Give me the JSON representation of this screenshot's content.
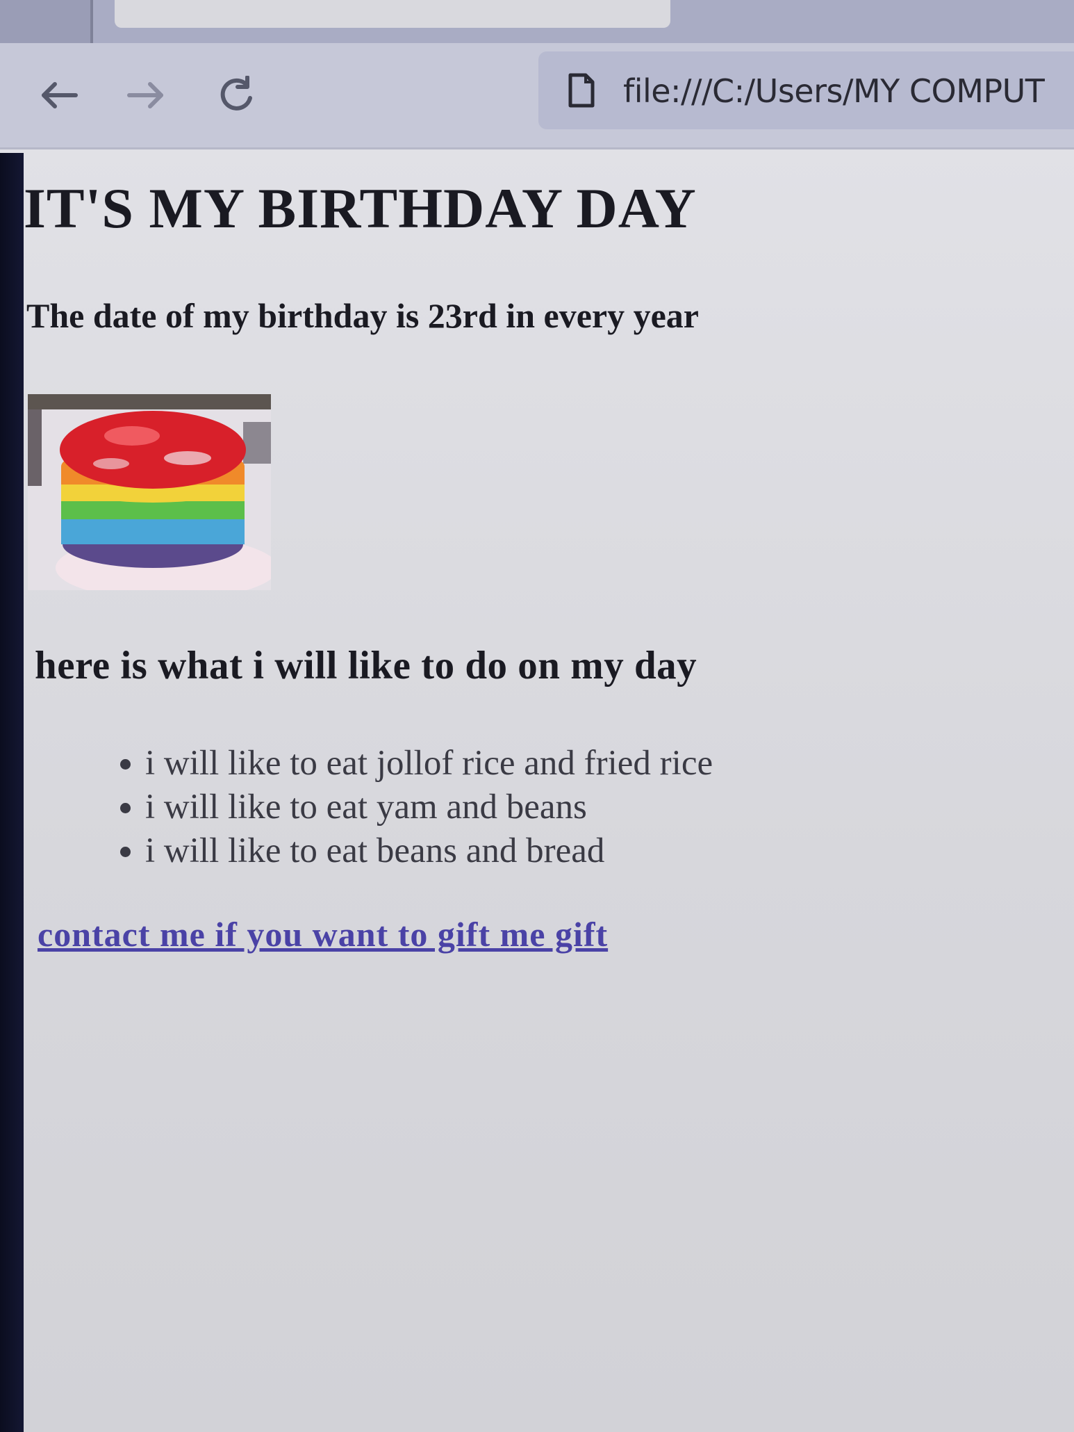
{
  "browser": {
    "url": "file:///C:/Users/MY COMPUT",
    "icons": {
      "back": "arrow-left-icon",
      "forward": "arrow-right-icon",
      "reload": "reload-icon",
      "page": "file-icon"
    }
  },
  "page": {
    "title": "IT'S MY BIRTHDAY DAY",
    "date_line": "The date of my birthday is 23rd in every year",
    "image": "cake-image",
    "plans_heading": "here is what i will like to do on my day",
    "wishes": [
      "i will like to eat jollof rice and fried rice",
      "i will like to eat yam and beans",
      "i will like to eat beans and bread"
    ],
    "gift_link": "contact me if you want to gift me gift",
    "colors": {
      "link": "#4a42a6",
      "text": "#1a1a22"
    }
  }
}
